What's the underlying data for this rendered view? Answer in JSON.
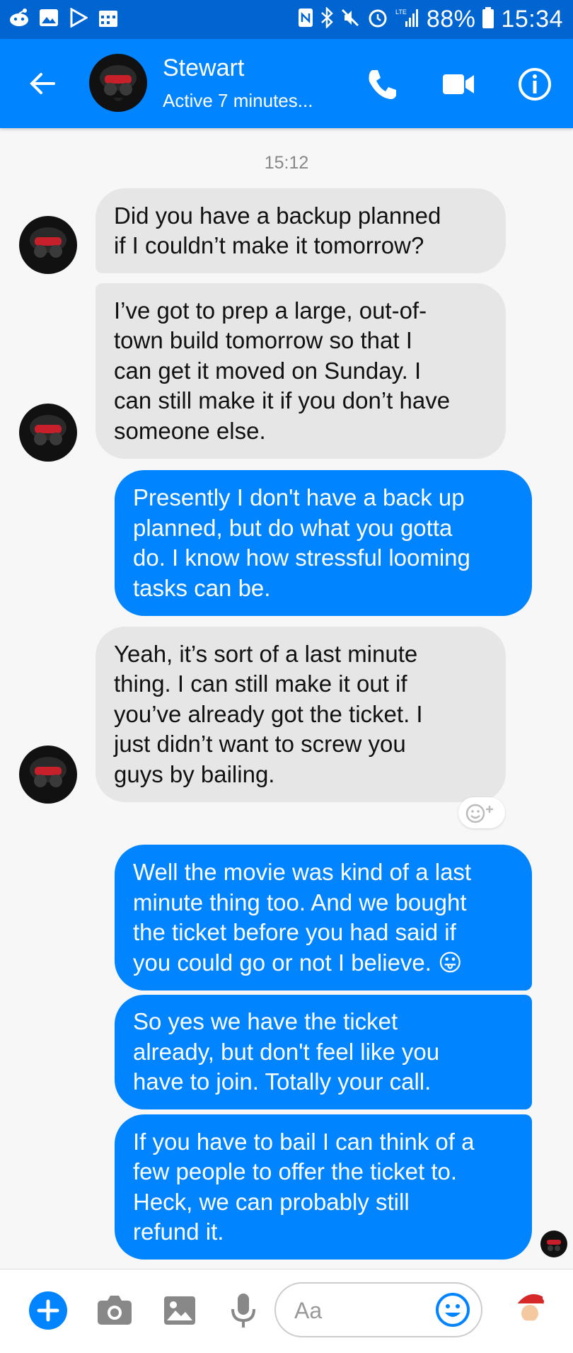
{
  "status_bar": {
    "battery": "88%",
    "time": "15:34",
    "network_label": "LTE"
  },
  "header": {
    "contact_name": "Stewart",
    "active_status": "Active 7 minutes...",
    "accent_color": "#0084ff"
  },
  "conversation": {
    "timestamp": "15:12",
    "messages": [
      {
        "sender": "contact",
        "text": "Did you have a backup planned\nif I couldn’t make it tomorrow?"
      },
      {
        "sender": "contact",
        "text": "I’ve got to prep a large, out-of-\ntown build tomorrow so that I\ncan get it moved on Sunday. I\ncan still make it if you don’t have\nsomeone else."
      },
      {
        "sender": "me",
        "text": "Presently I don't have a back up\nplanned, but do what you gotta\ndo. I know how stressful looming\ntasks can be."
      },
      {
        "sender": "contact",
        "text": "Yeah, it’s sort of a last minute\nthing. I can still make it out if\nyou’ve already got the ticket. I\njust didn’t want to screw you\nguys by bailing."
      },
      {
        "sender": "me",
        "text": "Well the movie was kind of a last\nminute thing too. And we bought\nthe ticket before you had said if\nyou could go or not I believe. 😛"
      },
      {
        "sender": "me",
        "text": "So yes we have the ticket\nalready, but don't feel like you\nhave to join. Totally your call."
      },
      {
        "sender": "me",
        "text": "If you have to bail I can think of a\nfew people to offer the ticket to.\nHeck, we can probably still\nrefund it."
      }
    ]
  },
  "composer": {
    "placeholder": "Aa"
  },
  "icons": {
    "status_left": [
      "reddit-icon",
      "gallery-icon",
      "play-store-icon",
      "calendar-icon"
    ],
    "status_right": [
      "nfc-icon",
      "bluetooth-icon",
      "mute-icon",
      "alarm-icon",
      "signal-icon",
      "battery-icon"
    ],
    "header": [
      "back-arrow-icon",
      "phone-icon",
      "video-camera-icon",
      "info-icon"
    ],
    "composer": [
      "plus-icon",
      "camera-icon",
      "image-icon",
      "microphone-icon",
      "emoji-icon",
      "santa-icon"
    ]
  },
  "colors": {
    "incoming_bubble": "#e6e6e6",
    "outgoing_bubble": "#0084ff",
    "status_bar": "#0065d1"
  }
}
